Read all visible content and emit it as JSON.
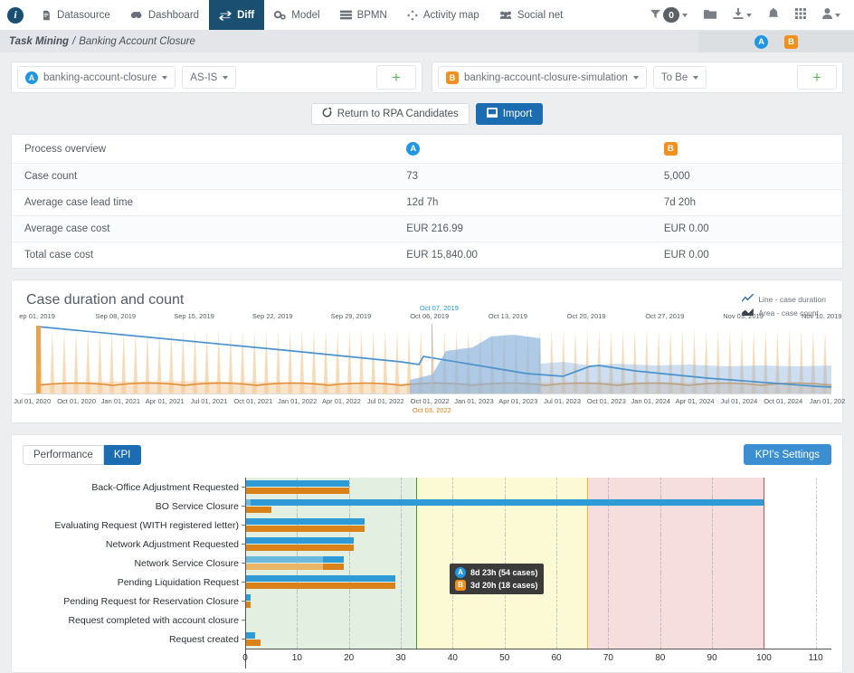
{
  "topnav": {
    "brand_letter": "i",
    "items": [
      {
        "label": "Datasource",
        "icon": "file-icon",
        "active": false
      },
      {
        "label": "Dashboard",
        "icon": "dashboard-icon",
        "active": false
      },
      {
        "label": "Diff",
        "icon": "diff-arrows-icon",
        "active": true
      },
      {
        "label": "Model",
        "icon": "model-gears-icon",
        "active": false
      },
      {
        "label": "BPMN",
        "icon": "bpmn-icon",
        "active": false
      },
      {
        "label": "Activity map",
        "icon": "activity-map-icon",
        "active": false
      },
      {
        "label": "Social net",
        "icon": "social-net-icon",
        "active": false
      }
    ],
    "filter_count": "0",
    "right_icons": [
      "filter-icon",
      "folder-icon",
      "download-icon",
      "bell-icon",
      "grid-icon",
      "user-icon"
    ]
  },
  "breadcrumb": {
    "root": "Task Mining",
    "separator": "/",
    "current": "Banking Account Closure",
    "badge_a": "A",
    "badge_b": "B"
  },
  "selectors": {
    "left": {
      "badge": "A",
      "process": "banking-account-closure",
      "variant": "AS-IS",
      "add_label": "+"
    },
    "right": {
      "badge": "B",
      "process": "banking-account-closure-simulation",
      "variant": "To Be",
      "add_label": "+"
    }
  },
  "actions": {
    "return_label": "Return to RPA Candidates",
    "import_label": "Import"
  },
  "overview": {
    "title": "Process overview",
    "col_a": "A",
    "col_b": "B",
    "rows": [
      {
        "label": "Case count",
        "a": "73",
        "b": "5,000"
      },
      {
        "label": "Average case lead time",
        "a": "12d 7h",
        "b": "7d 20h"
      },
      {
        "label": "Average case cost",
        "a": "EUR 216.99",
        "b": "EUR 0.00"
      },
      {
        "label": "Total case cost",
        "a": "EUR 15,840.00",
        "b": "EUR 0.00"
      }
    ]
  },
  "duration_chart": {
    "title": "Case duration and count",
    "legend": [
      {
        "label": "Line - case duration",
        "icon": "line-chart-icon"
      },
      {
        "label": "Area - case count",
        "icon": "area-chart-icon"
      }
    ],
    "tooltip": {
      "a_badge": "A",
      "a_value": "8d 23h (54 cases)",
      "b_badge": "B",
      "b_value": "3d 20h (18 cases)"
    },
    "top_axis_labels": [
      "ep 01, 2019",
      "Sep 08, 2019",
      "Sep 15, 2019",
      "Sep 22, 2019",
      "Sep 29, 2019",
      "Oct 06, 2019",
      "Oct 13, 2019",
      "Oct 20, 2019",
      "Oct 27, 2019",
      "Nov 03, 2019",
      "Nov 10, 2019"
    ],
    "top_axis_highlight": "Oct 07, 2019",
    "bottom_axis_labels": [
      "Jul 01, 2020",
      "Oct 01, 2020",
      "Jan 01, 2021",
      "Apr 01, 2021",
      "Jul 01, 2021",
      "Oct 01, 2021",
      "Jan 01, 2022",
      "Apr 01, 2022",
      "Jul 01, 2022",
      "Oct 01, 2022",
      "Jan 01, 2023",
      "Apr 01, 2023",
      "Jul 01, 2023",
      "Oct 01, 2023",
      "Jan 01, 2024",
      "Apr 01, 2024",
      "Jul 01, 2024",
      "Oct 01, 2024",
      "Jan 01, 202"
    ],
    "bottom_axis_highlight": "Oct 03, 2022"
  },
  "kpi": {
    "tabs": [
      {
        "label": "Performance",
        "active": false
      },
      {
        "label": "KPI",
        "active": true
      }
    ],
    "settings_label": "KPI's Settings"
  },
  "chart_data": {
    "type": "bar",
    "title": "",
    "xlabel": "",
    "ylabel": "",
    "orientation": "horizontal",
    "xlim": [
      0,
      113
    ],
    "xticks": [
      0,
      10,
      20,
      30,
      40,
      50,
      60,
      70,
      80,
      90,
      100,
      110
    ],
    "grid": true,
    "zones": [
      {
        "name": "green",
        "from": 0,
        "to": 33,
        "color": "#e3f0e1"
      },
      {
        "name": "yellow",
        "from": 33,
        "to": 66,
        "color": "#fbfad4"
      },
      {
        "name": "red",
        "from": 66,
        "to": 100,
        "color": "#f7dede"
      }
    ],
    "zone_lines": [
      {
        "at": 33,
        "color": "#3c9a3c"
      },
      {
        "at": 66,
        "color": "#f0b429"
      },
      {
        "at": 100,
        "color": "#b95252"
      }
    ],
    "categories": [
      "Back-Office Adjustment Requested",
      "BO Service Closure",
      "Evaluating Request (WITH registered letter)",
      "Network Adjustment Requested",
      "Network Service Closure",
      "Pending Liquidation Request",
      "Pending Request for Reservation Closure",
      "Request completed with account closure",
      "Request created"
    ],
    "series": [
      {
        "name": "A",
        "color": "#2e9ad6",
        "light_color": "#6cb9de",
        "values": [
          20,
          100,
          23,
          21,
          19,
          29,
          1,
          0,
          2
        ],
        "light_until": [
          0,
          1,
          0,
          0,
          15,
          0,
          0,
          0,
          0
        ]
      },
      {
        "name": "B",
        "color": "#d9821a",
        "light_color": "#e8b569",
        "values": [
          20,
          5,
          23,
          21,
          19,
          29,
          1,
          0,
          3
        ],
        "light_until": [
          0,
          0,
          0,
          0,
          15,
          0,
          0,
          0,
          0
        ]
      }
    ]
  }
}
